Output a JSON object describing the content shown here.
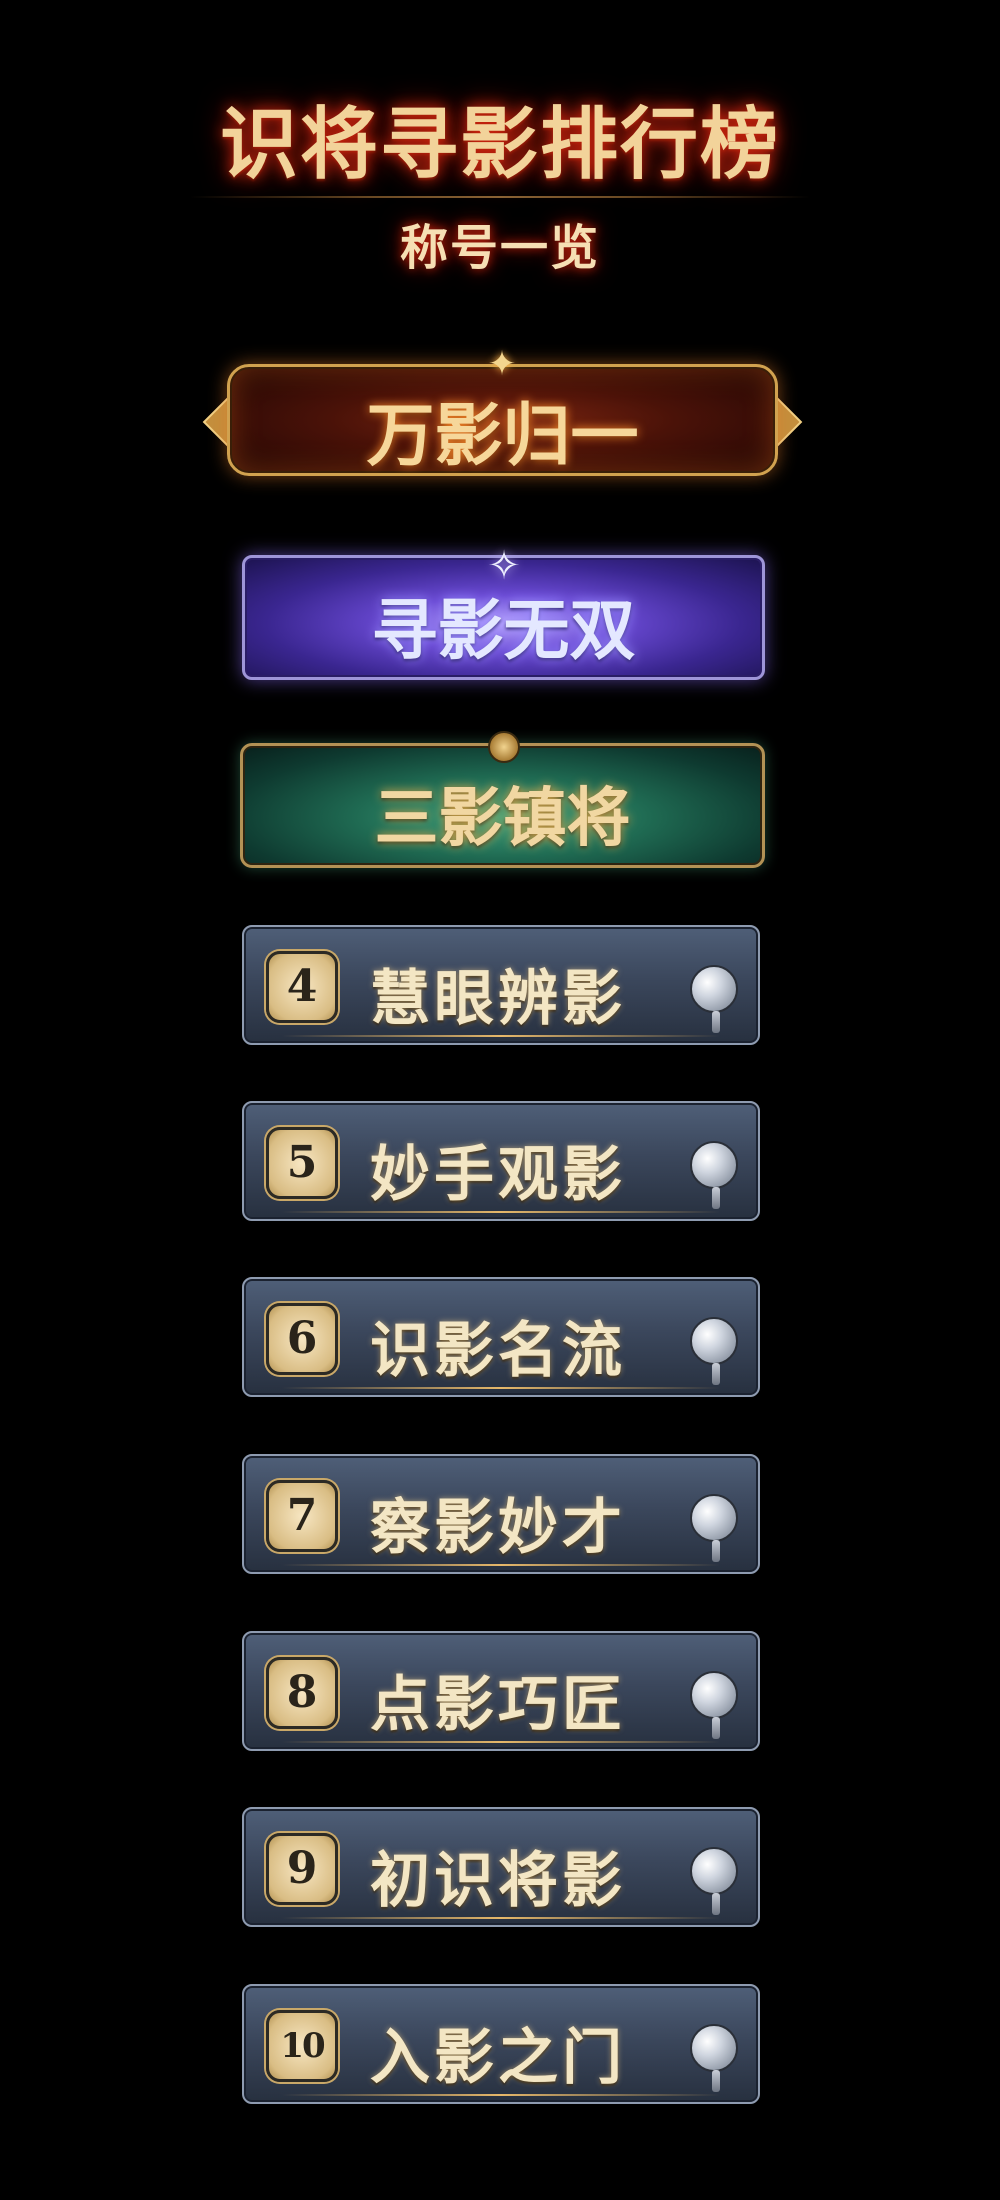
{
  "header": {
    "title": "识将寻影排行榜",
    "subtitle": "称号一览"
  },
  "ranks": [
    {
      "rank": "",
      "title": "万影归一",
      "style": "gold-red"
    },
    {
      "rank": "",
      "title": "寻影无双",
      "style": "violet"
    },
    {
      "rank": "",
      "title": "三影镇将",
      "style": "jade"
    },
    {
      "rank": "4",
      "title": "慧眼辨影",
      "style": "silver"
    },
    {
      "rank": "5",
      "title": "妙手观影",
      "style": "silver"
    },
    {
      "rank": "6",
      "title": "识影名流",
      "style": "silver"
    },
    {
      "rank": "7",
      "title": "察影妙才",
      "style": "silver"
    },
    {
      "rank": "8",
      "title": "点影巧匠",
      "style": "silver"
    },
    {
      "rank": "9",
      "title": "初识将影",
      "style": "silver"
    },
    {
      "rank": "10",
      "title": "入影之门",
      "style": "silver"
    }
  ],
  "colors": {
    "background": "#000000",
    "title_gold": "#f2d39a",
    "title_glow": "#d0260e"
  },
  "icons": {
    "tier1_ornament": "star-ornament-icon",
    "tier2_ornament": "sparkle-icon",
    "tier3_ornament": "medal-icon",
    "standard_ornament": "silver-orb-pendant-icon"
  }
}
